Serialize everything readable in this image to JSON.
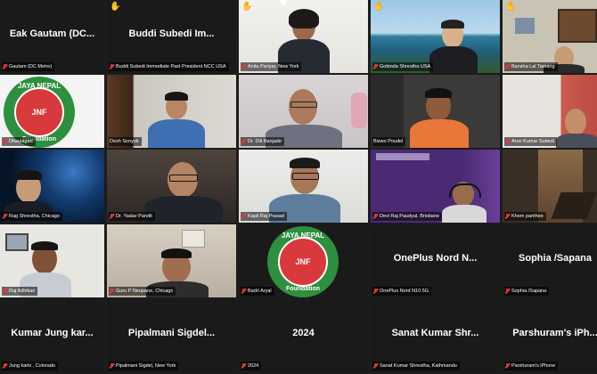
{
  "tiles": [
    {
      "name": "Eak Gautam (DC...",
      "label": "Gautam (DC Metro)",
      "type": "name"
    },
    {
      "name": "Buddi Subedi Im...",
      "label": "Buddi Subedi Immediate Past President NCC USA",
      "type": "name",
      "hand": true
    },
    {
      "label": "Anita Pariyar, New York",
      "type": "video",
      "hand": true
    },
    {
      "label": "Gobinda Shrestha USA",
      "type": "video",
      "hand": true
    },
    {
      "label": "Bansha Lal Tamang",
      "type": "video",
      "hand": true
    },
    {
      "label": "Dhaulagari",
      "type": "logo"
    },
    {
      "label": "Desh Sonyok",
      "type": "video",
      "speaker": true
    },
    {
      "label": "Dr. Dili Banjade",
      "type": "video"
    },
    {
      "label": "Biswo Poudel",
      "type": "video"
    },
    {
      "label": "Arun Kumar Subedi",
      "type": "video"
    },
    {
      "label": "Rag Shrestha, Chicago",
      "type": "video"
    },
    {
      "label": "Dr. Yadav Pandit",
      "type": "video"
    },
    {
      "label": "Kapil Raj Prasad",
      "type": "video"
    },
    {
      "label": "Devi Raj Paudyal, Brisbane",
      "type": "video"
    },
    {
      "label": "Khem panthee",
      "type": "video"
    },
    {
      "label": "Raj Adhikari",
      "type": "video"
    },
    {
      "label": "Guru P Neupane, Chicago",
      "type": "video"
    },
    {
      "label": "Badri Aryal",
      "type": "logo"
    },
    {
      "name": "OnePlus Nord N...",
      "label": "OnePlus Nord N10 5G",
      "type": "name"
    },
    {
      "name": "Sophia /Sapana",
      "label": "Sophia /Sapana",
      "type": "name"
    },
    {
      "name": "Kumar Jung kar...",
      "label": "Jung karki , Colorado",
      "type": "name"
    },
    {
      "name": "Pipalmani Sigdel...",
      "label": "Pipalmani Sigdel, New York",
      "type": "name"
    },
    {
      "name": "2024",
      "label": "2024",
      "type": "name"
    },
    {
      "name": "Sanat Kumar Shr...",
      "label": "Sanat Kumar Shrestha, Kathmandu",
      "type": "name"
    },
    {
      "name": "Parshuram's iPh...",
      "label": "Parshuram's iPhone",
      "type": "name"
    }
  ],
  "logo": {
    "top": "JAYA NEPAL",
    "center": "JNF",
    "bottom": "Foundation",
    "left": "ESTD",
    "right": "2022"
  },
  "colors": {
    "background": "#1c1c1c",
    "tile": "#1a1a1a",
    "speaker_border": "#c7d35a",
    "mute": "#e0383d",
    "logo_green": "#2e8f3f",
    "logo_red": "#d8393c"
  },
  "icons": {
    "mute": "mic-muted-icon",
    "hand": "raised-hand-icon"
  }
}
